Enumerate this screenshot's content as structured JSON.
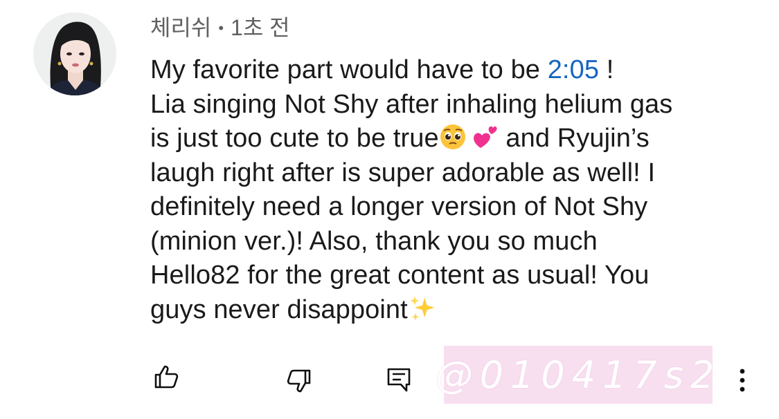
{
  "comment": {
    "author": "체리쉬",
    "separator": "•",
    "time": "1초 전",
    "text_before_timestamp": "My favorite part would have to be ",
    "timestamp": "2:05",
    "text_after_timestamp": " !",
    "line2": "Lia singing Not Shy after inhaling helium gas",
    "line3_start": "is just too cute to be true",
    "line3_end": " and Ryujin’s",
    "line4": "laugh right after is super adorable as well! I",
    "line5": "definitely need a longer version of Not Shy",
    "line6": "(minion ver.)! Also, thank you so much",
    "line7": "Hello82 for the great content as usual! You",
    "line8": "guys never disappoint",
    "emojis": [
      "pleading-face-icon",
      "two-hearts-icon",
      "sparkles-icon"
    ]
  },
  "watermark": {
    "text": "@010417s2"
  },
  "actions": {
    "icons": [
      "thumbs-up-icon",
      "thumbs-down-icon",
      "reply-icon",
      "more-vertical-icon"
    ]
  },
  "colors": {
    "timestamp": "#1565c0",
    "meta_text": "#606060",
    "body_text": "#1a1a1a",
    "watermark_bg": "#f7dff0"
  }
}
